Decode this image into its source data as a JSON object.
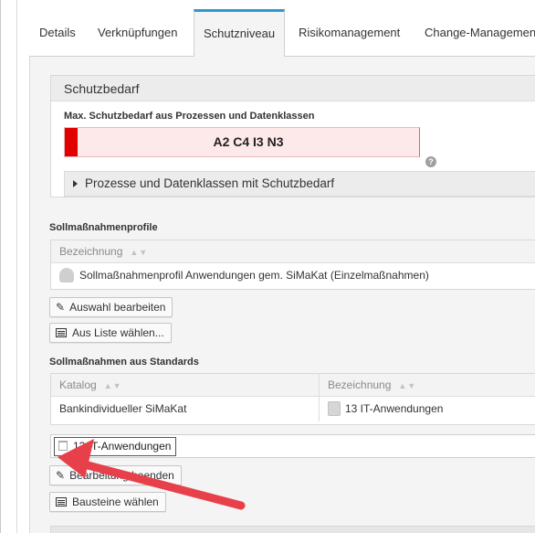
{
  "tabs": [
    {
      "label": "Details"
    },
    {
      "label": "Verknüpfungen"
    },
    {
      "label": "Schutzniveau"
    },
    {
      "label": "Risikomanagement"
    },
    {
      "label": "Change-Managemen"
    }
  ],
  "active_tab": "Schutzniveau",
  "schutzbedarf": {
    "title": "Schutzbedarf",
    "max_label": "Max. Schutzbedarf aus Prozessen und Datenklassen",
    "level": "A2 C4 I3 N3",
    "help_symbol": "?",
    "expander_label": "Prozesse und Datenklassen mit Schutzbedarf"
  },
  "profiles": {
    "title": "Sollmaßnahmenprofile",
    "column_header": "Bezeichnung",
    "rows": [
      {
        "icon": "umbrella-icon",
        "label": "Sollmaßnahmenprofil Anwendungen gem. SiMaKat (Einzelmaßnahmen)"
      }
    ],
    "edit_button": "Auswahl bearbeiten",
    "list_button": "Aus Liste wählen..."
  },
  "standards": {
    "title": "Sollmaßnahmen aus Standards",
    "columns": [
      "Katalog",
      "Bezeichnung"
    ],
    "rows": [
      {
        "katalog": "Bankindividueller SiMaKat",
        "bezeichnung": "13 IT-Anwendungen",
        "icon": "doc-icon"
      }
    ],
    "tag": "13 IT-Anwendungen",
    "edit_button": "Bearbeitung beenden",
    "modules_button": "Bausteine wählen"
  },
  "colors": {
    "accent": "#2c9ad1",
    "level_red": "#e00000",
    "level_bg": "#fde9e9",
    "annotation_arrow": "#e8404a"
  }
}
